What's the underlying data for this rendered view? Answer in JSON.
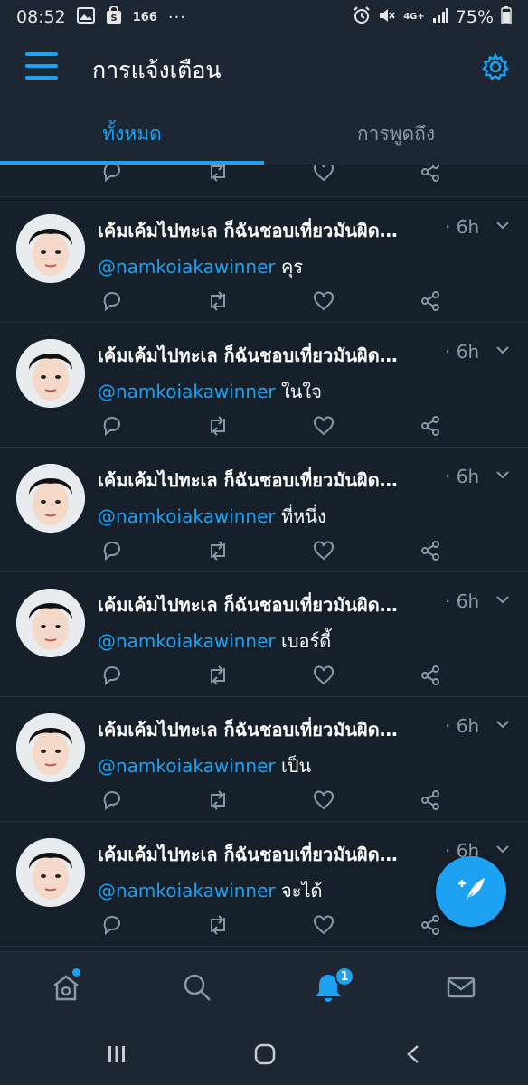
{
  "status_bar": {
    "time": "08:52",
    "notification_count": "166",
    "more": "···",
    "network": "4G+",
    "battery": "75%"
  },
  "header": {
    "title": "การแจ้งเตือน"
  },
  "tabs": [
    {
      "label": "ทั้งหมด",
      "active": true
    },
    {
      "label": "การพูดถึง",
      "active": false
    }
  ],
  "notifications": [
    {
      "title": "เค้มเค้มไปทะเล ก็ฉันชอบเที่ยวมันผิด…",
      "time": "· 6h",
      "mention": "@namkoiakawinner",
      "reply": "คุร"
    },
    {
      "title": "เค้มเค้มไปทะเล ก็ฉันชอบเที่ยวมันผิด…",
      "time": "· 6h",
      "mention": "@namkoiakawinner",
      "reply": "ในใจ"
    },
    {
      "title": "เค้มเค้มไปทะเล ก็ฉันชอบเที่ยวมันผิด…",
      "time": "· 6h",
      "mention": "@namkoiakawinner",
      "reply": "ที่หนึ่ง"
    },
    {
      "title": "เค้มเค้มไปทะเล ก็ฉันชอบเที่ยวมันผิด…",
      "time": "· 6h",
      "mention": "@namkoiakawinner",
      "reply": "เบอร์ดี้"
    },
    {
      "title": "เค้มเค้มไปทะเล ก็ฉันชอบเที่ยวมันผิด…",
      "time": "· 6h",
      "mention": "@namkoiakawinner",
      "reply": "เป็น"
    },
    {
      "title": "เค้มเค้มไปทะเล ก็ฉันชอบเที่ยวมันผิด…",
      "time": "· 6h",
      "mention": "@namkoiakawinner",
      "reply": "จะได้"
    }
  ],
  "bottom_nav": {
    "notifications_badge": "1"
  },
  "colors": {
    "accent": "#1da1f2",
    "background": "#15202b",
    "surface": "#1c2733",
    "muted": "#8899a6"
  }
}
